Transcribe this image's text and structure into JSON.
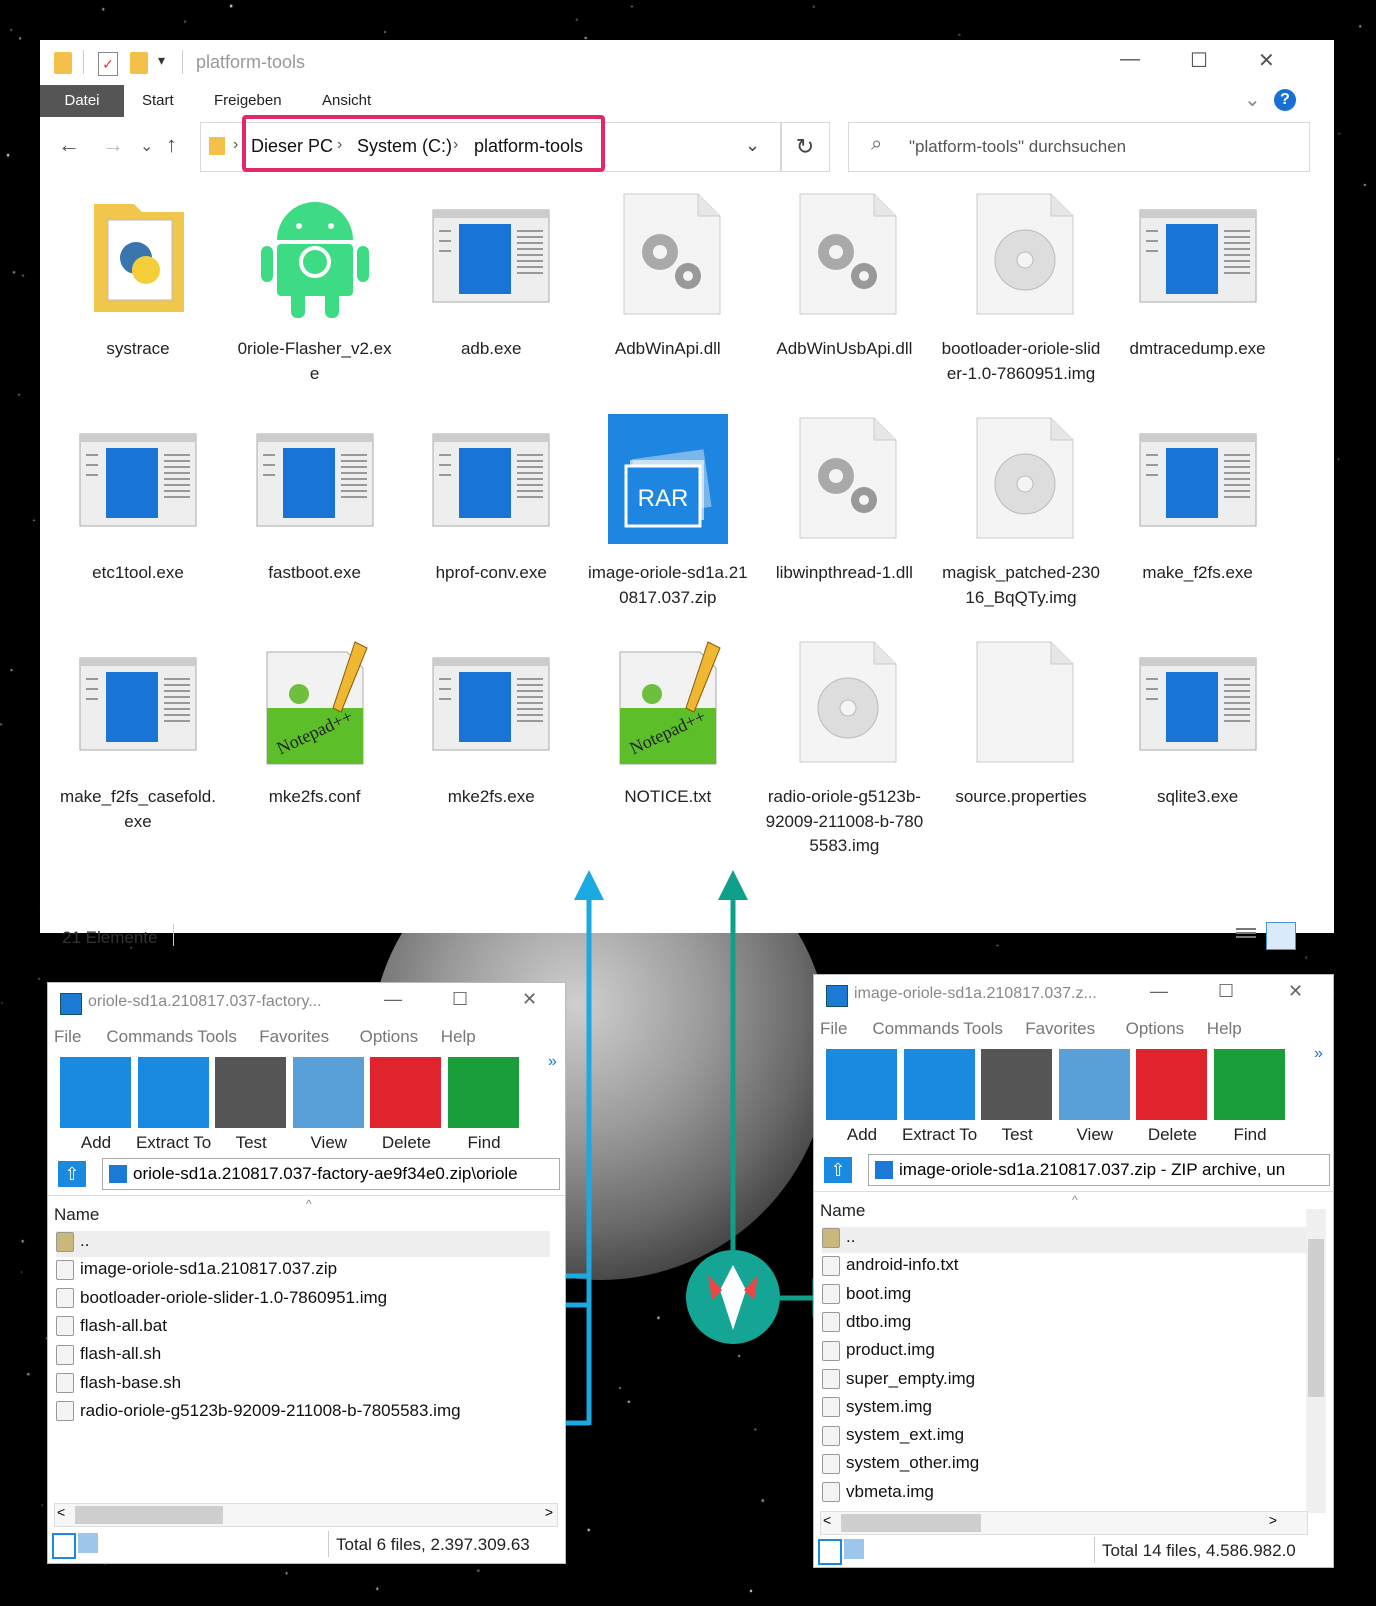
{
  "explorer": {
    "title": "platform-tools",
    "ribbon_tabs": [
      "Datei",
      "Start",
      "Freigeben",
      "Ansicht"
    ],
    "breadcrumb": [
      "Dieser PC",
      "System (C:)",
      "platform-tools"
    ],
    "search_placeholder": "\"platform-tools\" durchsuchen",
    "status": "21 Elemente",
    "files": [
      {
        "name": "systrace",
        "icon": "python-folder-icon"
      },
      {
        "name": "0riole-Flasher_v2.exe",
        "icon": "android-icon"
      },
      {
        "name": "adb.exe",
        "icon": "exe-window-icon"
      },
      {
        "name": "AdbWinApi.dll",
        "icon": "dll-gear-icon"
      },
      {
        "name": "AdbWinUsbApi.dll",
        "icon": "dll-gear-icon"
      },
      {
        "name": "bootloader-oriole-slider-1.0-7860951.img",
        "icon": "disc-image-icon"
      },
      {
        "name": "dmtracedump.exe",
        "icon": "exe-window-icon"
      },
      {
        "name": "etc1tool.exe",
        "icon": "exe-window-icon"
      },
      {
        "name": "fastboot.exe",
        "icon": "exe-window-icon"
      },
      {
        "name": "hprof-conv.exe",
        "icon": "exe-window-icon"
      },
      {
        "name": "image-oriole-sd1a.210817.037.zip",
        "icon": "rar-archive-icon"
      },
      {
        "name": "libwinpthread-1.dll",
        "icon": "dll-gear-icon"
      },
      {
        "name": "magisk_patched-23016_BqQTy.img",
        "icon": "disc-image-icon"
      },
      {
        "name": "make_f2fs.exe",
        "icon": "exe-window-icon"
      },
      {
        "name": "make_f2fs_casefold.exe",
        "icon": "exe-window-icon"
      },
      {
        "name": "mke2fs.conf",
        "icon": "notepad-icon"
      },
      {
        "name": "mke2fs.exe",
        "icon": "exe-window-icon"
      },
      {
        "name": "NOTICE.txt",
        "icon": "notepad-icon"
      },
      {
        "name": "radio-oriole-g5123b-92009-211008-b-7805583.img",
        "icon": "disc-image-icon"
      },
      {
        "name": "source.properties",
        "icon": "blank-file-icon"
      },
      {
        "name": "sqlite3.exe",
        "icon": "exe-window-icon"
      }
    ]
  },
  "rar_left": {
    "title": "oriole-sd1a.210817.037-factory...",
    "menu": [
      "File",
      "Commands",
      "Tools",
      "Favorites",
      "Options",
      "Help"
    ],
    "buttons": [
      "Add",
      "Extract To",
      "Test",
      "View",
      "Delete",
      "Find"
    ],
    "path": "oriole-sd1a.210817.037-factory-ae9f34e0.zip\\oriole",
    "column": "Name",
    "rows": [
      "..",
      "image-oriole-sd1a.210817.037.zip",
      "bootloader-oriole-slider-1.0-7860951.img",
      "flash-all.bat",
      "flash-all.sh",
      "flash-base.sh",
      "radio-oriole-g5123b-92009-211008-b-7805583.img"
    ],
    "status": "Total 6 files, 2.397.309.63"
  },
  "rar_right": {
    "title": "image-oriole-sd1a.210817.037.z...",
    "menu": [
      "File",
      "Commands",
      "Tools",
      "Favorites",
      "Options",
      "Help"
    ],
    "buttons": [
      "Add",
      "Extract To",
      "Test",
      "View",
      "Delete",
      "Find"
    ],
    "path": "image-oriole-sd1a.210817.037.zip - ZIP archive, un",
    "column": "Name",
    "rows": [
      "..",
      "android-info.txt",
      "boot.img",
      "dtbo.img",
      "product.img",
      "super_empty.img",
      "system.img",
      "system_ext.img",
      "system_other.img",
      "vbmeta.img"
    ],
    "status": "Total 14 files, 4.586.982.0"
  },
  "colors": {
    "blue_arrow": "#1ba9e1",
    "teal_arrow": "#0fa08c",
    "highlight": "#e0286a",
    "magisk": "#14a594"
  }
}
